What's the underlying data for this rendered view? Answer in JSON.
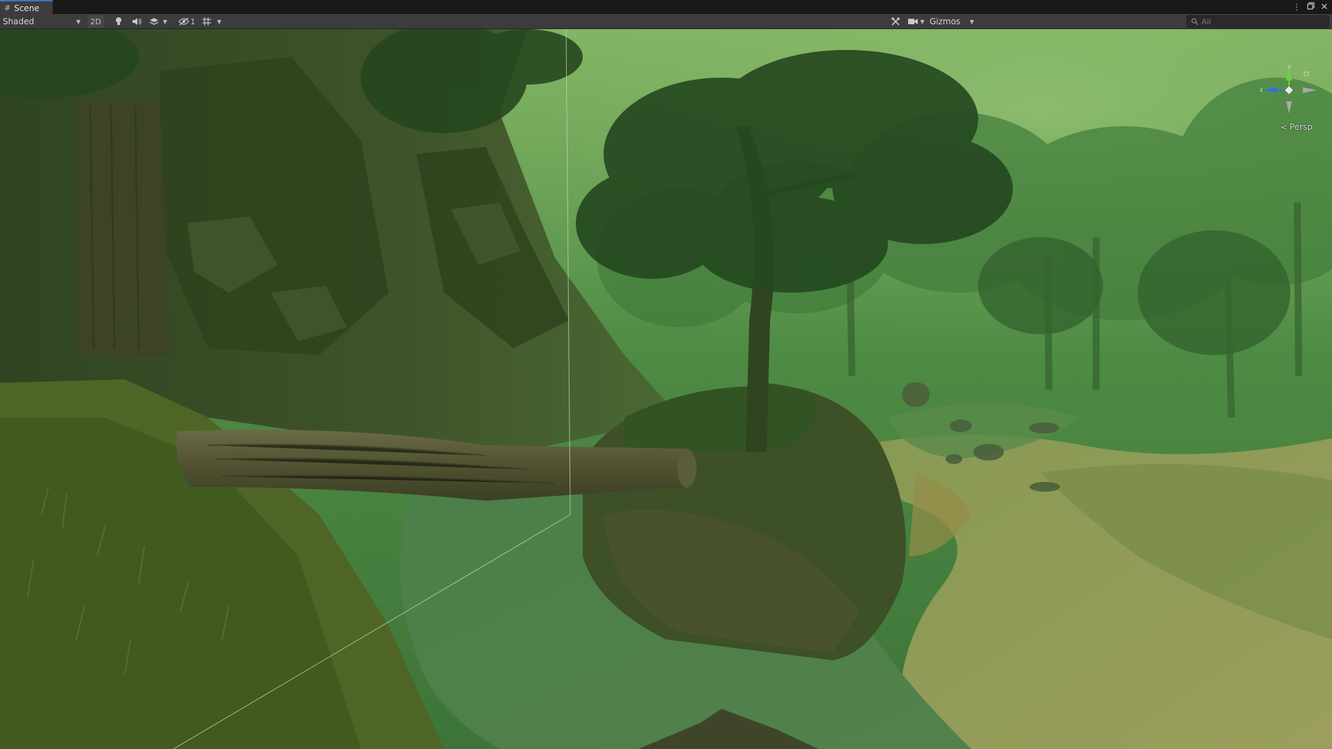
{
  "window": {
    "tab_title": "Scene",
    "icons": [
      "hash-icon",
      "kebab-menu-icon",
      "maximize-icon",
      "close-icon"
    ]
  },
  "toolbar": {
    "draw_mode": "Shaded",
    "mode_2d_label": "2D",
    "hidden_count": "1",
    "gizmos_label": "Gizmos",
    "search_placeholder": "All"
  },
  "viewport": {
    "projection_label": "Persp",
    "axes": {
      "y": "y",
      "z": "z"
    }
  },
  "colors": {
    "toolbar_bg": "#3c3c3c",
    "tab_active_accent": "#3a79bb",
    "axis_y": "#6fd03e",
    "axis_z": "#2f6fe8",
    "axis_x_neg": "#a9a9a9"
  }
}
